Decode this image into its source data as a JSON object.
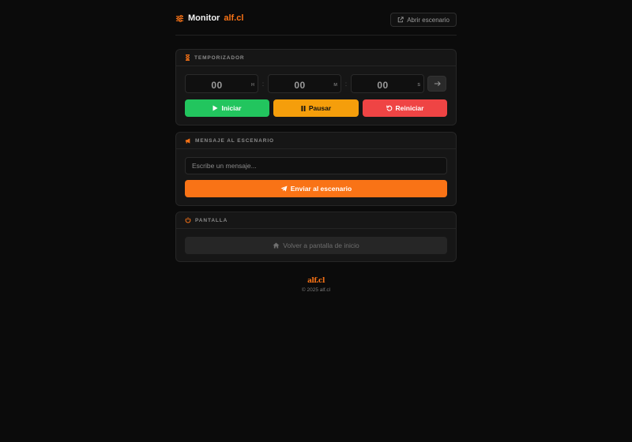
{
  "header": {
    "title": "Monitor",
    "title_accent": "alf.cl",
    "open_stage_label": "Abrir escenario"
  },
  "timer": {
    "section_title": "TEMPORIZADOR",
    "hours": "00",
    "hours_unit": "H",
    "minutes": "00",
    "minutes_unit": "M",
    "seconds": "00",
    "seconds_unit": "S",
    "separator": ":",
    "start_label": "Iniciar",
    "pause_label": "Pausar",
    "reset_label": "Reiniciar"
  },
  "message": {
    "section_title": "MENSAJE AL ESCENARIO",
    "placeholder": "Escribe un mensaje...",
    "send_label": "Enviar al escenario"
  },
  "screen": {
    "section_title": "PANTALLA",
    "home_label": "Volver a pantalla de inicio"
  },
  "footer": {
    "logo_text": "alf.cl",
    "copyright": "© 2025 alf.cl"
  },
  "colors": {
    "accent": "#f97316",
    "start": "#22c55e",
    "pause": "#f59e0b",
    "reset": "#ef4444",
    "background": "#0b0b0b"
  },
  "icons": {
    "brand": "sliders-icon",
    "open_stage": "external-link-icon",
    "timer": "hourglass-icon",
    "set_timer": "arrow-right-icon",
    "start": "play-icon",
    "pause": "pause-icon",
    "reset": "rotate-ccw-icon",
    "message": "megaphone-icon",
    "send": "paper-plane-icon",
    "screen": "power-icon",
    "home": "home-icon"
  }
}
